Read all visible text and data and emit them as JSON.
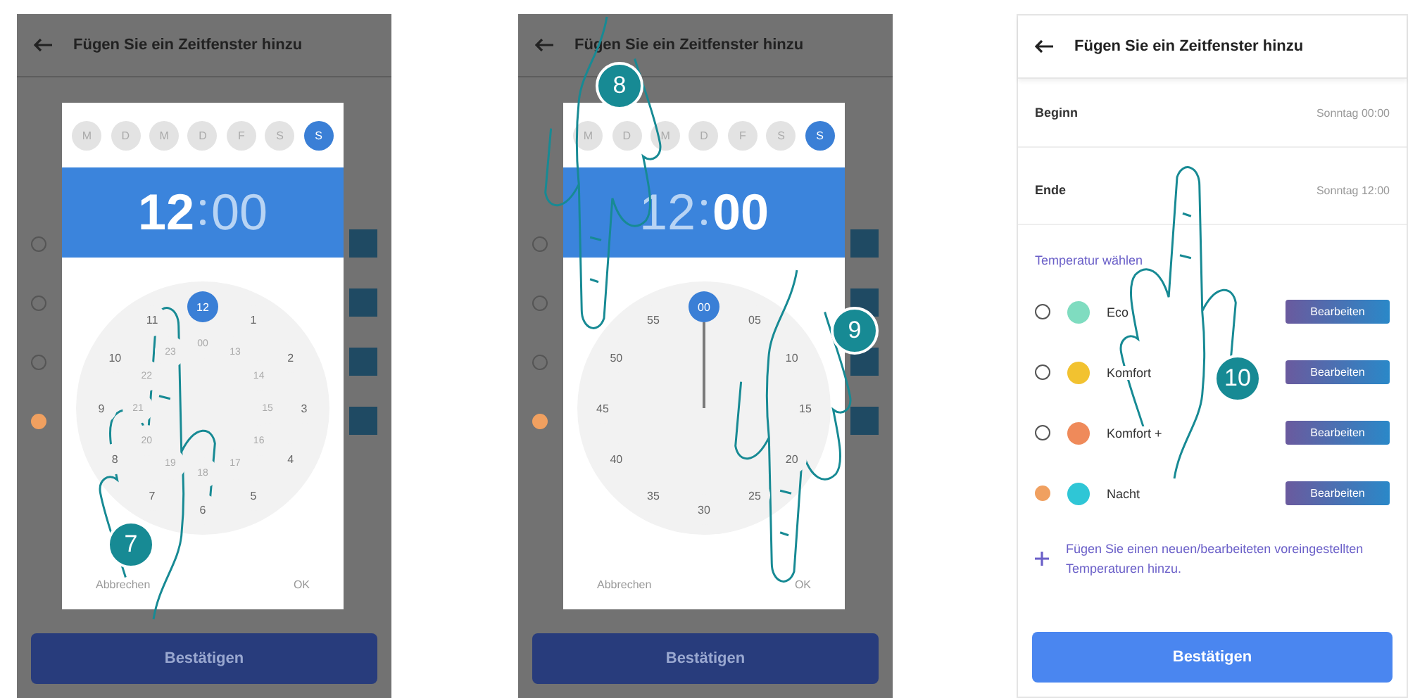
{
  "panels": [
    {
      "kind": "dial",
      "title": "Fügen Sie ein Zeitfenster hinzu",
      "confirm": "Bestätigen",
      "rows": [
        {
          "selected": false
        },
        {
          "selected": false
        },
        {
          "selected": false
        },
        {
          "selected": true
        }
      ],
      "dialog": {
        "days": [
          {
            "label": "M",
            "selected": false
          },
          {
            "label": "D",
            "selected": false
          },
          {
            "label": "M",
            "selected": false
          },
          {
            "label": "D",
            "selected": false
          },
          {
            "label": "F",
            "selected": false
          },
          {
            "label": "S",
            "selected": false
          },
          {
            "label": "S",
            "selected": true
          }
        ],
        "hours": {
          "value": "12",
          "selected": true
        },
        "minutes": {
          "value": "00",
          "selected": false
        },
        "outer": [
          {
            "label": "12",
            "selected": true
          },
          {
            "label": "1",
            "selected": false
          },
          {
            "label": "2",
            "selected": false
          },
          {
            "label": "3",
            "selected": false
          },
          {
            "label": "4",
            "selected": false
          },
          {
            "label": "5",
            "selected": false
          },
          {
            "label": "6",
            "selected": false
          },
          {
            "label": "7",
            "selected": false
          },
          {
            "label": "8",
            "selected": false
          },
          {
            "label": "9",
            "selected": false
          },
          {
            "label": "10",
            "selected": false
          },
          {
            "label": "11",
            "selected": false
          }
        ],
        "inner": [
          "00",
          "13",
          "14",
          "15",
          "16",
          "17",
          "18",
          "19",
          "20",
          "21",
          "22",
          "23"
        ],
        "buttons": [
          "Abbrechen",
          "OK"
        ]
      },
      "steps": [
        "7"
      ]
    },
    {
      "kind": "dial",
      "title": "Fügen Sie ein Zeitfenster hinzu",
      "confirm": "Bestätigen",
      "rows": [
        {
          "selected": false
        },
        {
          "selected": false
        },
        {
          "selected": false
        },
        {
          "selected": true
        }
      ],
      "dialog": {
        "days": [
          {
            "label": "M",
            "selected": false
          },
          {
            "label": "D",
            "selected": false
          },
          {
            "label": "M",
            "selected": false
          },
          {
            "label": "D",
            "selected": false
          },
          {
            "label": "F",
            "selected": false
          },
          {
            "label": "S",
            "selected": false
          },
          {
            "label": "S",
            "selected": true
          }
        ],
        "hours": {
          "value": "12",
          "selected": false
        },
        "minutes": {
          "value": "00",
          "selected": true
        },
        "outer": [
          {
            "label": "00",
            "selected": true
          },
          {
            "label": "05",
            "selected": false
          },
          {
            "label": "10",
            "selected": false
          },
          {
            "label": "15",
            "selected": false
          },
          {
            "label": "20",
            "selected": false
          },
          {
            "label": "25",
            "selected": false
          },
          {
            "label": "30",
            "selected": false
          },
          {
            "label": "35",
            "selected": false
          },
          {
            "label": "40",
            "selected": false
          },
          {
            "label": "45",
            "selected": false
          },
          {
            "label": "50",
            "selected": false
          },
          {
            "label": "55",
            "selected": false
          }
        ],
        "buttons": [
          "Abbrechen",
          "OK"
        ]
      },
      "steps": [
        "8",
        "9"
      ]
    },
    {
      "kind": "form",
      "title": "Fügen Sie ein Zeitfenster hinzu",
      "confirm": "Bestätigen",
      "fields": [
        {
          "label": "Beginn",
          "value": "Sonntag 00:00"
        },
        {
          "label": "Ende",
          "value": "Sonntag 12:00"
        }
      ],
      "section": "Temperatur wählen",
      "temperatures": [
        {
          "name": "Eco",
          "color": "#7fdcc0",
          "selected": false,
          "action": "Bearbeiten"
        },
        {
          "name": "Komfort",
          "color": "#f2c230",
          "selected": false,
          "action": "Bearbeiten"
        },
        {
          "name": "Komfort +",
          "color": "#ef8a5a",
          "selected": false,
          "action": "Bearbeiten"
        },
        {
          "name": "Nacht",
          "color": "#2fc6d6",
          "selected": true,
          "action": "Bearbeiten"
        }
      ],
      "add_link": "Fügen Sie einen neuen/bearbeiteten voreingestellten Temperaturen hinzu.",
      "steps": [
        "10"
      ]
    }
  ]
}
